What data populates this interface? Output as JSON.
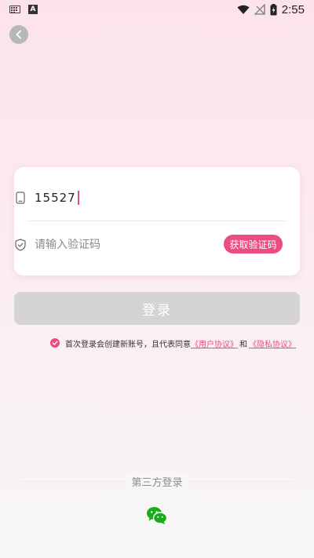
{
  "status_bar": {
    "time": "2:55",
    "app_badge": "A"
  },
  "form": {
    "phone_value": "15527",
    "code_placeholder": "请输入验证码",
    "get_code_label": "获取验证码"
  },
  "login_label": "登录",
  "agreement": {
    "prefix": "首次登录会创建新账号，且代表同意",
    "user_agreement": "《用户协议》",
    "conjunction": "和",
    "privacy_policy": "《隐私协议》"
  },
  "third_party": {
    "title": "第三方登录",
    "providers": [
      "wechat-icon"
    ]
  },
  "colors": {
    "accent": "#ec4c82",
    "login_disabled": "#d4d4d6",
    "wechat_green": "#1aad19"
  }
}
